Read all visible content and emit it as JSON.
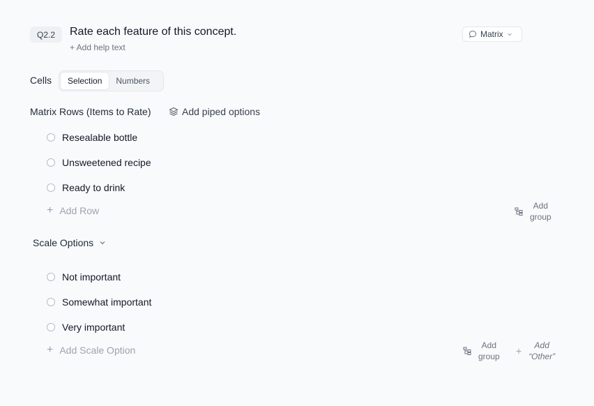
{
  "question": {
    "id": "Q2.2",
    "title": "Rate each feature of this concept.",
    "help_text": "+ Add help text",
    "type_label": "Matrix"
  },
  "cells": {
    "label": "Cells",
    "options": [
      "Selection",
      "Numbers"
    ],
    "selected": "Selection"
  },
  "rows": {
    "heading": "Matrix Rows (Items to Rate)",
    "piped_label": "Add piped options",
    "items": [
      "Resealable bottle",
      "Unsweetened recipe",
      "Ready to drink"
    ],
    "add_label": "Add Row",
    "add_group_line1": "Add",
    "add_group_line2": "group"
  },
  "scale": {
    "heading": "Scale Options",
    "items": [
      "Not important",
      "Somewhat important",
      "Very important"
    ],
    "add_label": "Add Scale Option",
    "add_group_line1": "Add",
    "add_group_line2": "group",
    "add_other_line1": "Add",
    "add_other_line2": "“Other”"
  },
  "icons": {
    "type": "chat-bubble-icon",
    "dropdown": "chevron-down-icon",
    "piped": "layers-icon",
    "group": "hierarchy-icon",
    "plus": "plus-icon"
  },
  "colors": {
    "background": "#f9fafb",
    "muted_text": "#9ca3af",
    "badge_bg": "#eef0f3"
  }
}
